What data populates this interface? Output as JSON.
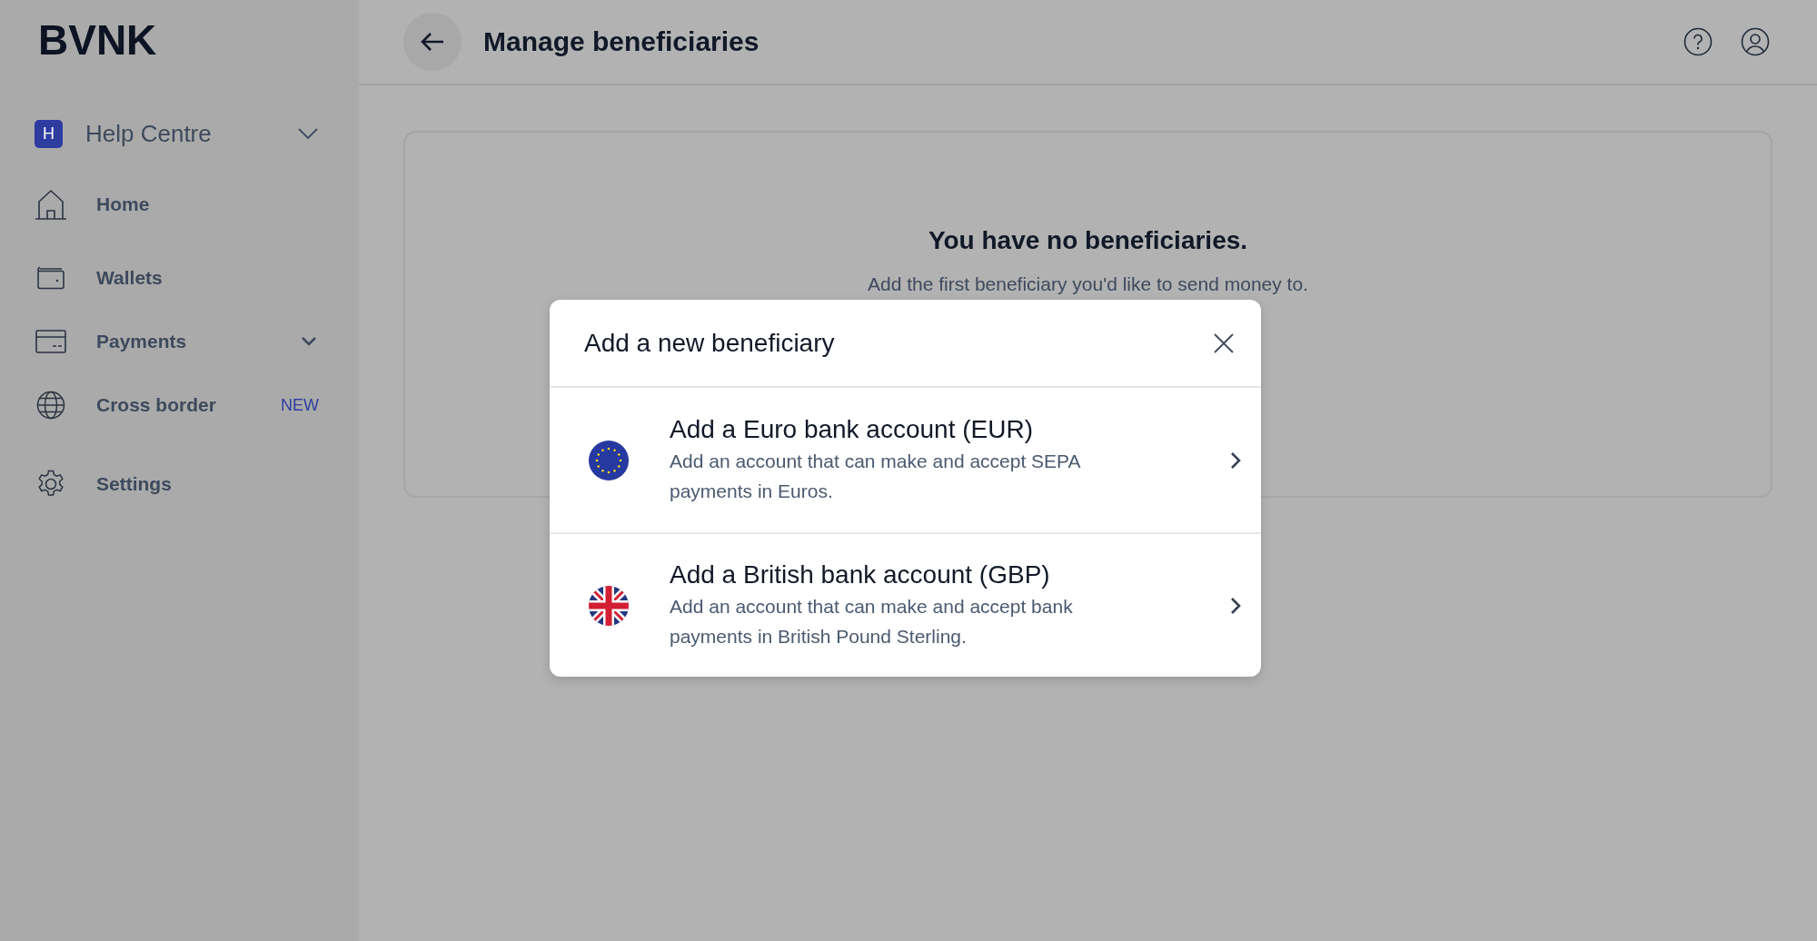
{
  "sidebar": {
    "logo": "BVNK",
    "workspace": {
      "initial": "H",
      "name": "Help Centre"
    },
    "groups": [
      [
        {
          "label": "Home",
          "kind": "home",
          "expandable": false
        }
      ],
      [
        {
          "label": "Wallets",
          "kind": "wallet",
          "expandable": false
        },
        {
          "label": "Payments",
          "kind": "card",
          "expandable": true
        },
        {
          "label": "Cross border",
          "kind": "globe",
          "expandable": false,
          "badge": "NEW"
        }
      ],
      [
        {
          "label": "Settings",
          "kind": "gear",
          "expandable": false
        }
      ]
    ]
  },
  "header": {
    "title": "Manage beneficiaries"
  },
  "empty_state": {
    "title": "You have no beneficiaries.",
    "message": "Add the first beneficiary you'd like to send money to."
  },
  "modal": {
    "title": "Add a new beneficiary",
    "options": [
      {
        "kind": "eu",
        "title": "Add a Euro bank account (EUR)",
        "description": "Add an account that can make and accept SEPA payments in Euros."
      },
      {
        "kind": "uk",
        "title": "Add a British bank account (GBP)",
        "description": "Add an account that can make and accept bank payments in British Pound Sterling."
      }
    ]
  }
}
